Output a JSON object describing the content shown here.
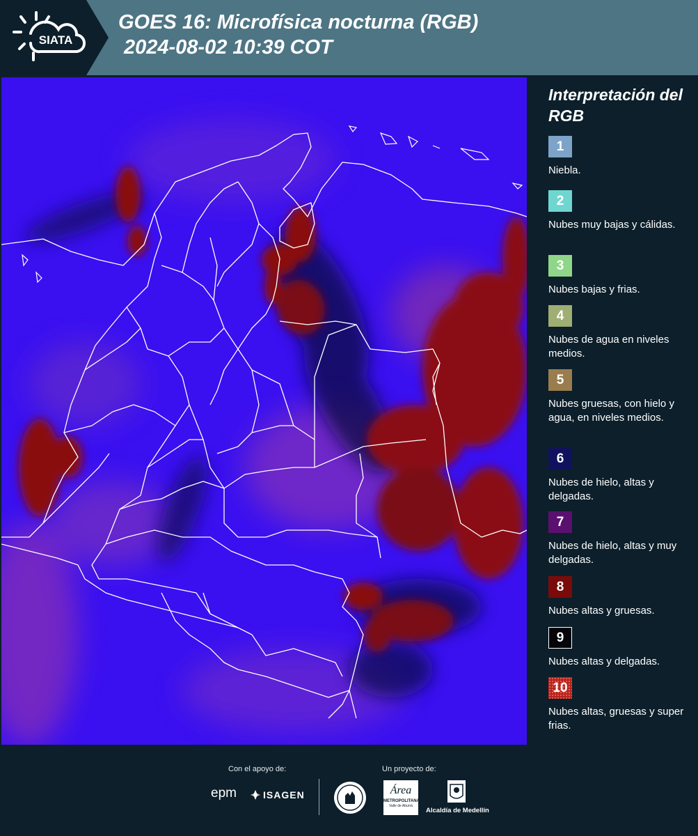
{
  "header": {
    "logo_text": "SIATA",
    "title_line1": "GOES 16: Microfísica nocturna (RGB)",
    "title_line2": "2024-08-02 10:39 COT"
  },
  "legend": {
    "title": "Interpretación del RGB",
    "items": [
      {
        "num": "1",
        "color": "#7ea3c8",
        "text": "Niebla."
      },
      {
        "num": "2",
        "color": "#6fd6cf",
        "text": "Nubes muy bajas y cálidas."
      },
      {
        "num": "3",
        "color": "#8fd68a",
        "text": "Nubes bajas y frias."
      },
      {
        "num": "4",
        "color": "#9fae72",
        "text": "Nubes de agua en niveles medios."
      },
      {
        "num": "5",
        "color": "#9a7d4e",
        "text": "Nubes gruesas, con hielo y agua, en niveles medios."
      },
      {
        "num": "6",
        "color": "#10125e",
        "text": "Nubes de hielo, altas y delgadas."
      },
      {
        "num": "7",
        "color": "#5b1070",
        "text": "Nubes de hielo, altas y muy delgadas."
      },
      {
        "num": "8",
        "color": "#7a0b0b",
        "text": "Nubes altas y gruesas."
      },
      {
        "num": "9",
        "color": "#050509",
        "text": "Nubes altas y delgadas."
      },
      {
        "num": "10",
        "color": "#b8231a",
        "text": "Nubes altas, gruesas y super frias."
      }
    ]
  },
  "footer": {
    "support_label": "Con el apoyo de:",
    "project_label": "Un proyecto de:",
    "sponsor_epm": "epm",
    "sponsor_isagen": "ISAGEN",
    "sponsor_area_line1": "Área",
    "sponsor_area_line2": "METROPOLITANA",
    "sponsor_area_line3": "Valle de Aburrá",
    "sponsor_alcaldia": "Alcaldía de Medellín"
  },
  "map": {
    "background_color": "#3a10f0",
    "cloud_color": "#8a0a10",
    "border_color": "#ffffff"
  }
}
